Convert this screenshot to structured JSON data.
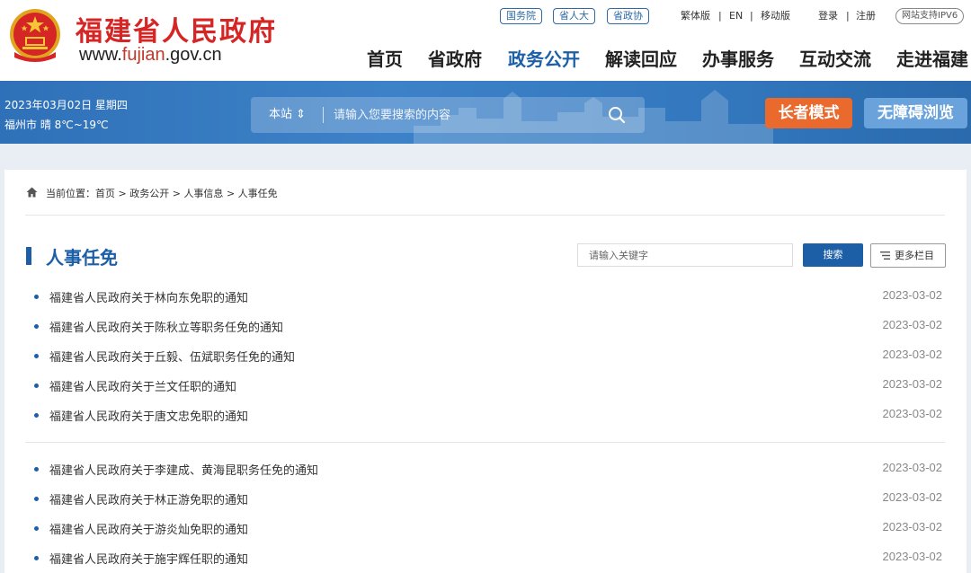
{
  "header": {
    "site_name": "福建省人民政府",
    "site_url_prefix": "www.",
    "site_url_domain": "fujian",
    "site_url_suffix": ".gov.cn",
    "tags": [
      "国务院",
      "省人大",
      "省政协"
    ],
    "lang_links": [
      "繁体版",
      "EN",
      "移动版"
    ],
    "separator": "|",
    "login": "登录",
    "register": "注册",
    "ipv6": "网站支持IPV6",
    "nav": [
      "首页",
      "省政府",
      "政务公开",
      "解读回应",
      "办事服务",
      "互动交流",
      "走进福建"
    ],
    "active_nav": "政务公开"
  },
  "banner": {
    "date": "2023年03月02日 星期四",
    "weather": "福州市 晴 8℃~19℃",
    "search_scope": "本站",
    "search_placeholder": "请输入您要搜索的内容",
    "elder_mode": "长者模式",
    "accessible": "无障碍浏览"
  },
  "breadcrumb": {
    "label": "当前位置：",
    "items": [
      "首页",
      "政务公开",
      "人事信息",
      "人事任免"
    ],
    "sep": ">"
  },
  "section": {
    "title": "人事任免",
    "keyword_placeholder": "请输入关键字",
    "search_button": "搜索",
    "more_button": "更多栏目"
  },
  "list_group_1": [
    {
      "title": "福建省人民政府关于林向东免职的通知",
      "date": "2023-03-02"
    },
    {
      "title": "福建省人民政府关于陈秋立等职务任免的通知",
      "date": "2023-03-02"
    },
    {
      "title": "福建省人民政府关于丘毅、伍斌职务任免的通知",
      "date": "2023-03-02"
    },
    {
      "title": "福建省人民政府关于兰文任职的通知",
      "date": "2023-03-02"
    },
    {
      "title": "福建省人民政府关于唐文忠免职的通知",
      "date": "2023-03-02"
    }
  ],
  "list_group_2": [
    {
      "title": "福建省人民政府关于李建成、黄海昆职务任免的通知",
      "date": "2023-03-02"
    },
    {
      "title": "福建省人民政府关于林正游免职的通知",
      "date": "2023-03-02"
    },
    {
      "title": "福建省人民政府关于游炎灿免职的通知",
      "date": "2023-03-02"
    },
    {
      "title": "福建省人民政府关于施宇辉任职的通知",
      "date": "2023-03-02"
    }
  ],
  "colors": {
    "brand_red": "#d52525",
    "primary_blue": "#1d5fa6",
    "elder_orange": "#ea6a2d",
    "banner_blue": "#3479c0"
  }
}
